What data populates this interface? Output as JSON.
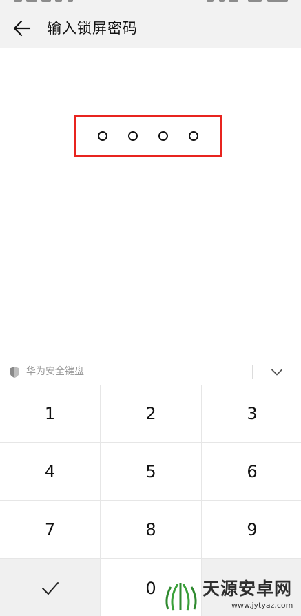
{
  "header": {
    "title": "输入锁屏密码",
    "back_icon": "arrow-left-icon"
  },
  "pin_entry": {
    "length": 4,
    "filled": 0,
    "highlight_color": "#e8241f"
  },
  "keyboard": {
    "name": "华为安全键盘",
    "shield_icon": "shield-icon",
    "collapse_icon": "chevron-down-icon",
    "keys": {
      "k1": "1",
      "k2": "2",
      "k3": "3",
      "k4": "4",
      "k5": "5",
      "k6": "6",
      "k7": "7",
      "k8": "8",
      "k9": "9",
      "k0": "0"
    },
    "confirm_icon": "checkmark-icon"
  },
  "watermark": {
    "brand": "天源安卓网",
    "url": "www.jytyaz.com"
  }
}
